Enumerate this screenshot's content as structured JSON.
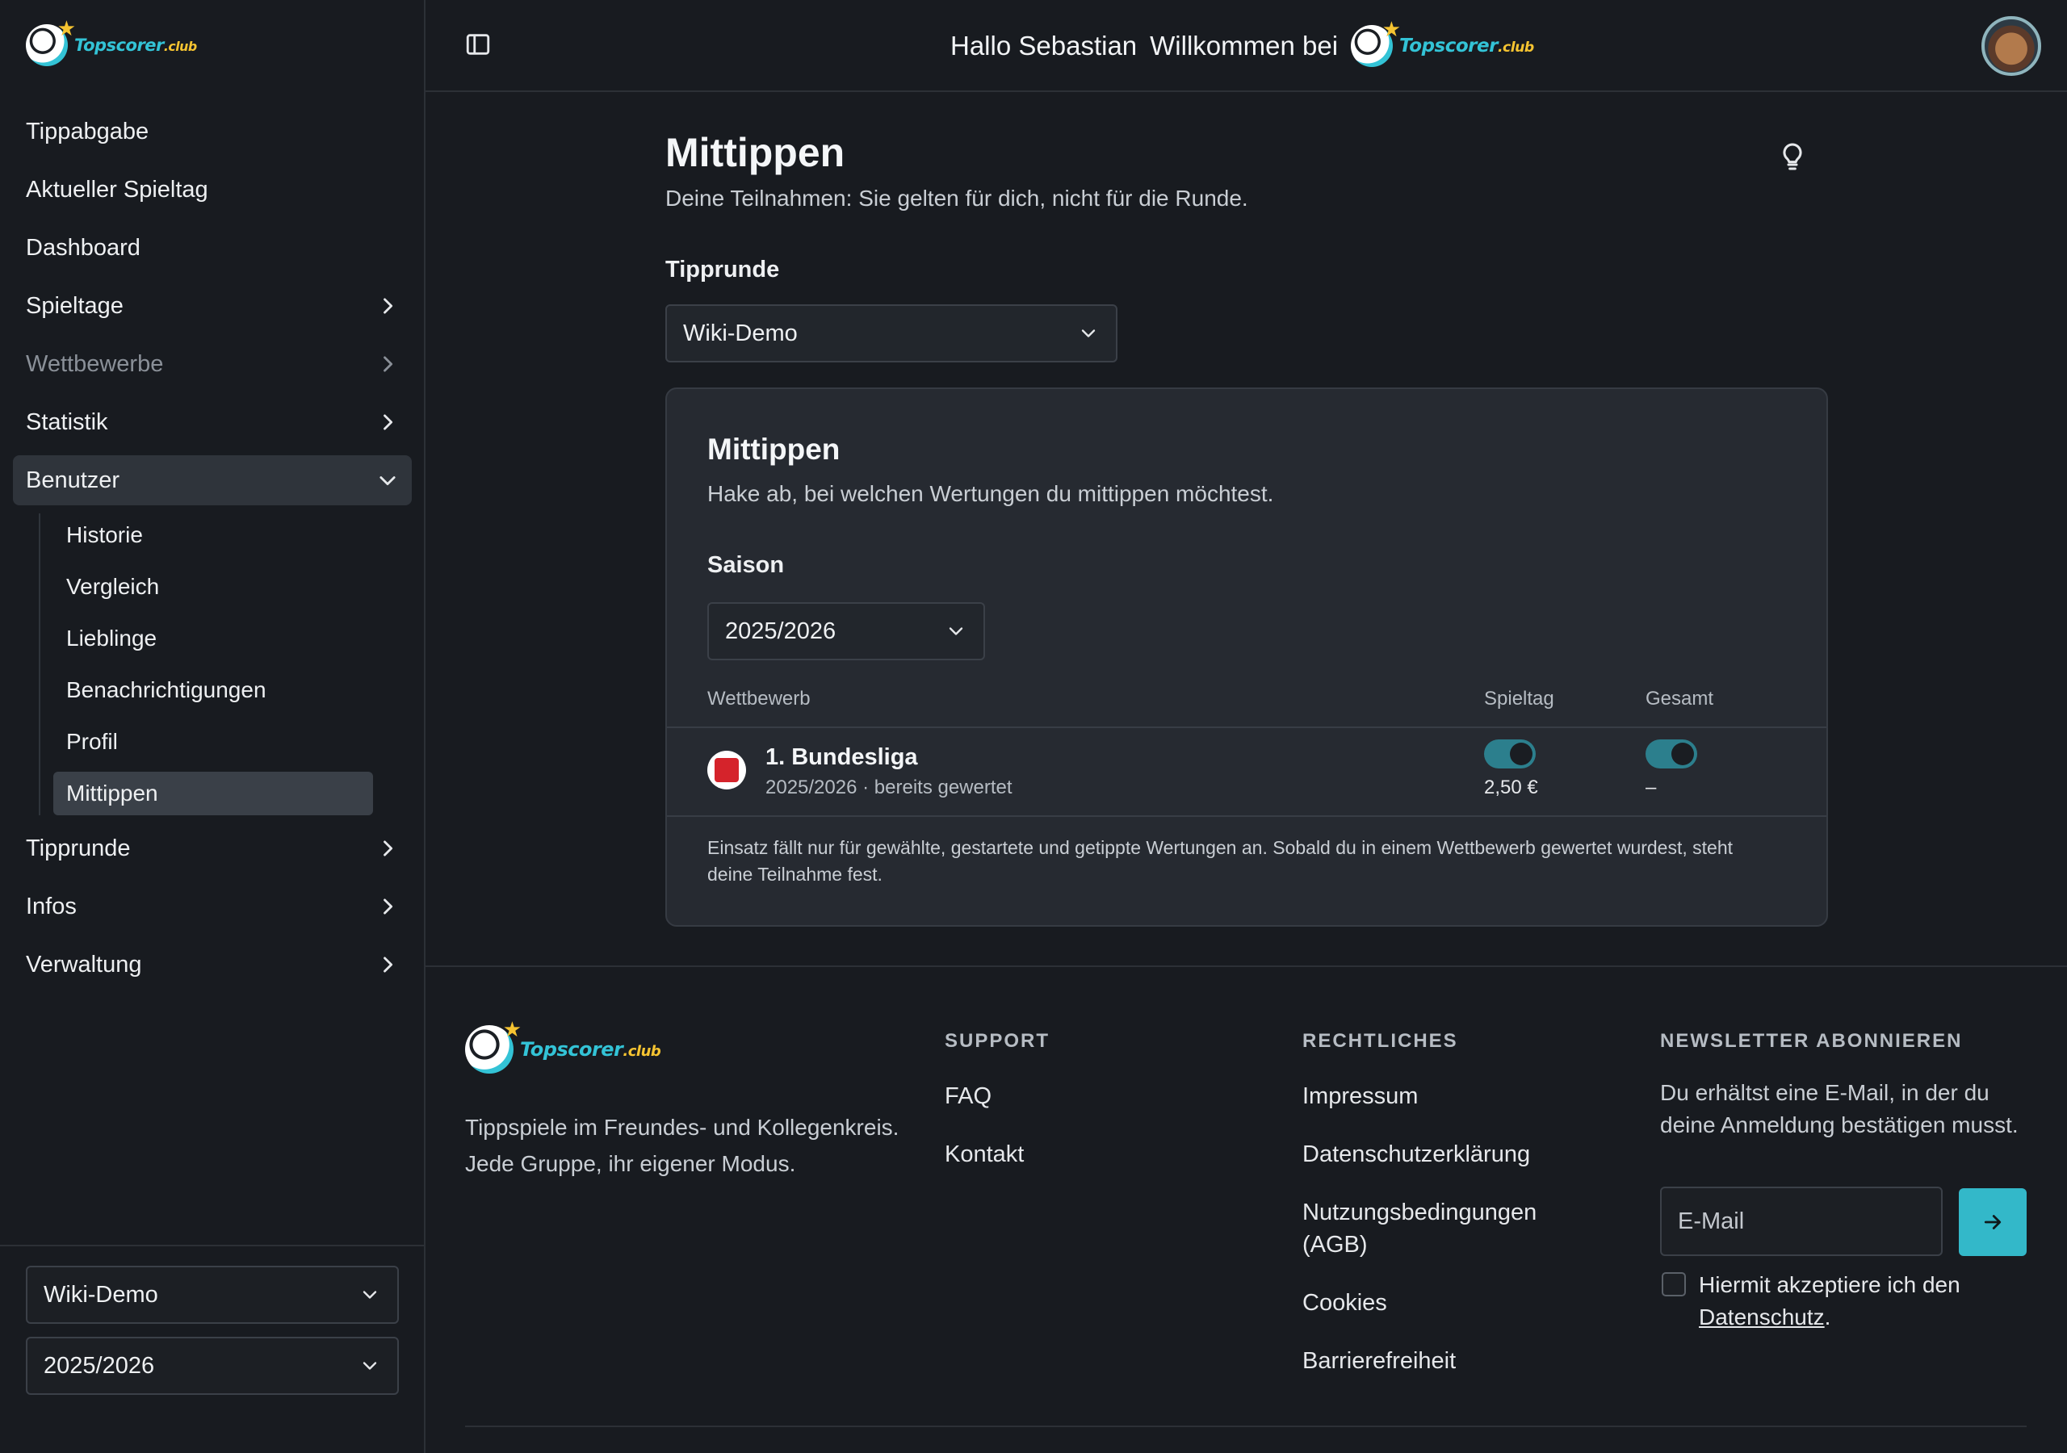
{
  "brand": {
    "name": "Topscorer",
    "suffix": ".club"
  },
  "sidebar": {
    "items": [
      {
        "label": "Tippabgabe"
      },
      {
        "label": "Aktueller Spieltag"
      },
      {
        "label": "Dashboard"
      },
      {
        "label": "Spieltage"
      },
      {
        "label": "Wettbewerbe"
      },
      {
        "label": "Statistik"
      },
      {
        "label": "Benutzer"
      },
      {
        "label": "Tipprunde"
      },
      {
        "label": "Infos"
      },
      {
        "label": "Verwaltung"
      }
    ],
    "benutzer_sub": [
      {
        "label": "Historie"
      },
      {
        "label": "Vergleich"
      },
      {
        "label": "Lieblinge"
      },
      {
        "label": "Benachrichtigungen"
      },
      {
        "label": "Profil"
      },
      {
        "label": "Mittippen"
      }
    ],
    "round_select": "Wiki-Demo",
    "season_select": "2025/2026"
  },
  "header": {
    "greeting": "Hallo Sebastian",
    "welcome": "Willkommen bei"
  },
  "main": {
    "title": "Mittippen",
    "subtitle": "Deine Teilnahmen: Sie gelten für dich, nicht für die Runde.",
    "round_label": "Tipprunde",
    "round_value": "Wiki-Demo",
    "card": {
      "title": "Mittippen",
      "subtitle": "Hake ab, bei welchen Wertungen du mittippen möchtest.",
      "season_label": "Saison",
      "season_value": "2025/2026",
      "columns": {
        "competition": "Wettbewerb",
        "matchday": "Spieltag",
        "total": "Gesamt"
      },
      "rows": [
        {
          "name": "1. Bundesliga",
          "meta": "2025/2026 · bereits gewertet",
          "matchday_enabled": true,
          "matchday_value": "2,50 €",
          "total_enabled": true,
          "total_value": "–"
        }
      ],
      "note": "Einsatz fällt nur für gewählte, gestartete und getippte Wertungen an. Sobald du in einem Wettbewerb gewertet wurdest, steht deine Teilnahme fest."
    }
  },
  "footer": {
    "description": "Tippspiele im Freundes- und Kollegenkreis. Jede Gruppe, ihr eigener Modus.",
    "support": {
      "heading": "SUPPORT",
      "links": [
        "FAQ",
        "Kontakt"
      ]
    },
    "legal": {
      "heading": "RECHTLICHES",
      "links": [
        "Impressum",
        "Datenschutzerklärung",
        "Nutzungsbedingungen (AGB)",
        "Cookies",
        "Barrierefreiheit"
      ]
    },
    "newsletter": {
      "heading": "NEWSLETTER ABONNIEREN",
      "text": "Du erhältst eine E-Mail, in der du deine Anmeldung bestätigen musst.",
      "email_placeholder": "E-Mail",
      "consent_prefix": "Hiermit akzeptiere ich den",
      "consent_link": "Datenschutz",
      "consent_suffix": "."
    }
  },
  "colors": {
    "accent": "#33b8c9",
    "toggle": "#2c7f8d",
    "star": "#f6c431"
  }
}
